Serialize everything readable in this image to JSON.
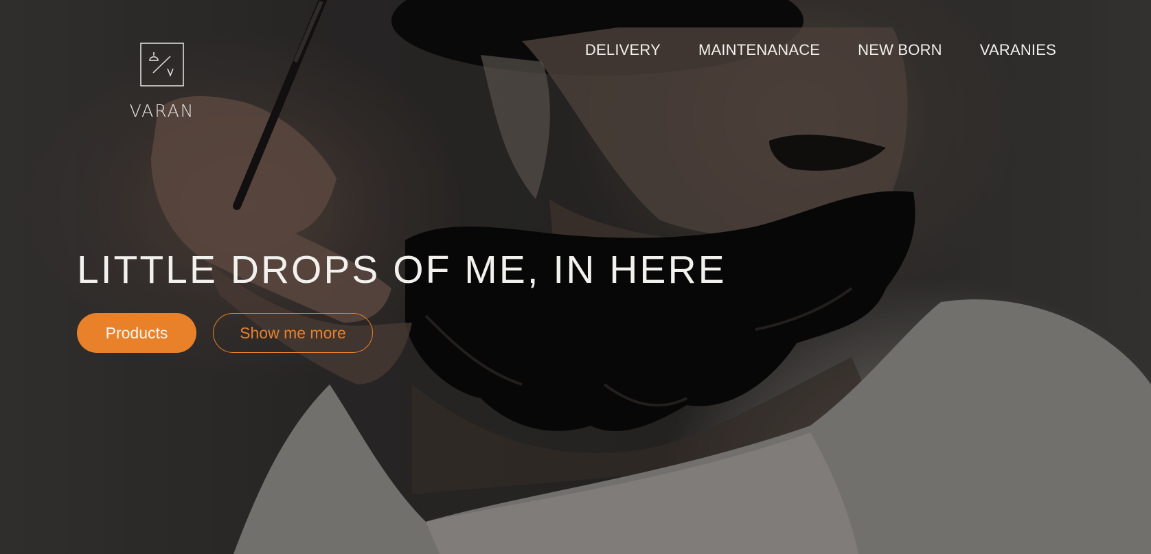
{
  "brand": {
    "name": "VARAN",
    "accent_color": "#e8812a"
  },
  "nav": {
    "items": [
      {
        "label": "DELIVERY"
      },
      {
        "label": "MAINTENANACE"
      },
      {
        "label": "NEW BORN"
      },
      {
        "label": "VARANIES"
      }
    ]
  },
  "hero": {
    "headline": "LITTLE DROPS OF ME, IN HERE",
    "primary_button": "Products",
    "secondary_button": "Show me more"
  }
}
